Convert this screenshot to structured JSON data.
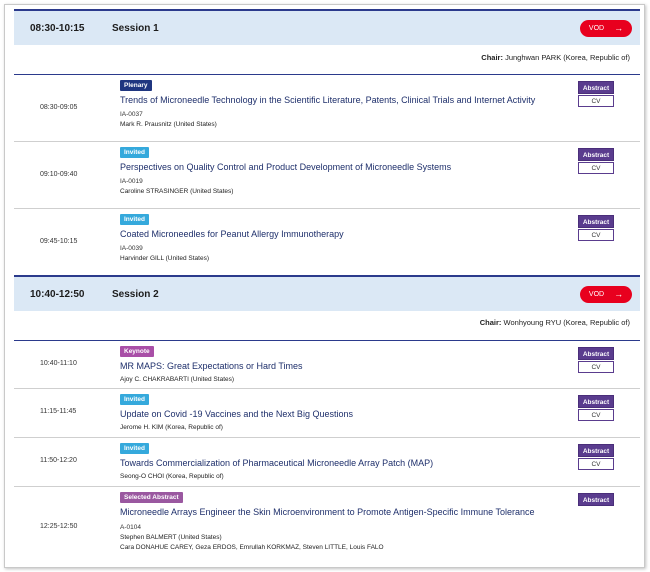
{
  "sessions": [
    {
      "time": "08:30-10:15",
      "name": "Session 1",
      "vod_label": "VOD",
      "chair_label": "Chair:",
      "chair_name": "Junghwan PARK (Korea, Republic of)",
      "talks": [
        {
          "time": "08:30-09:05",
          "badge": "Plenary",
          "title": "Trends of Microneedle Technology in the Scientific Literature, Patents, Clinical Trials and Internet Activity",
          "code": "IA-0037",
          "authors": [
            "Mark R. Prausnitz (United States)"
          ],
          "abstract_label": "Abstract",
          "cv_label": "CV"
        },
        {
          "time": "09:10-09:40",
          "badge": "Invited",
          "title": "Perspectives on Quality Control and Product Development of Microneedle Systems",
          "code": "IA-0019",
          "authors": [
            "Caroline STRASINGER (United States)"
          ],
          "abstract_label": "Abstract",
          "cv_label": "CV"
        },
        {
          "time": "09:45-10:15",
          "badge": "Invited",
          "title": "Coated Microneedles for Peanut Allergy Immunotherapy",
          "code": "IA-0039",
          "authors": [
            "Harvinder GILL (United States)"
          ],
          "abstract_label": "Abstract",
          "cv_label": "CV"
        }
      ]
    },
    {
      "time": "10:40-12:50",
      "name": "Session 2",
      "vod_label": "VOD",
      "chair_label": "Chair:",
      "chair_name": "Wonhyoung RYU (Korea, Republic of)",
      "talks": [
        {
          "time": "10:40-11:10",
          "badge": "Keynote",
          "title": "MR MAPS: Great Expectations or Hard Times",
          "code": "",
          "authors": [
            "Ajoy C. CHAKRABARTI (United States)"
          ],
          "abstract_label": "Abstract",
          "cv_label": "CV"
        },
        {
          "time": "11:15-11:45",
          "badge": "Invited",
          "title": "Update on Covid -19 Vaccines and the Next Big Questions",
          "code": "",
          "authors": [
            "Jerome H. KIM (Korea, Republic of)"
          ],
          "abstract_label": "Abstract",
          "cv_label": "CV"
        },
        {
          "time": "11:50-12:20",
          "badge": "Invited",
          "title": "Towards Commercialization of Pharmaceutical Microneedle Array Patch (MAP)",
          "code": "",
          "authors": [
            "Seong-O CHOI (Korea, Republic of)"
          ],
          "abstract_label": "Abstract",
          "cv_label": "CV"
        },
        {
          "time": "12:25-12:50",
          "badge": "Selected Abstract",
          "title": "Microneedle Arrays Engineer the Skin Microenvironment to Promote Antigen-Specific Immune Tolerance",
          "code": "A-0104",
          "authors": [
            "Stephen BALMERT (United States)",
            "Cara DONAHUE CAREY, Geza ERDOS, Emrullah KORKMAZ, Steven LITTLE, Louis FALO"
          ],
          "abstract_label": "Abstract",
          "cv_label": ""
        }
      ]
    }
  ]
}
